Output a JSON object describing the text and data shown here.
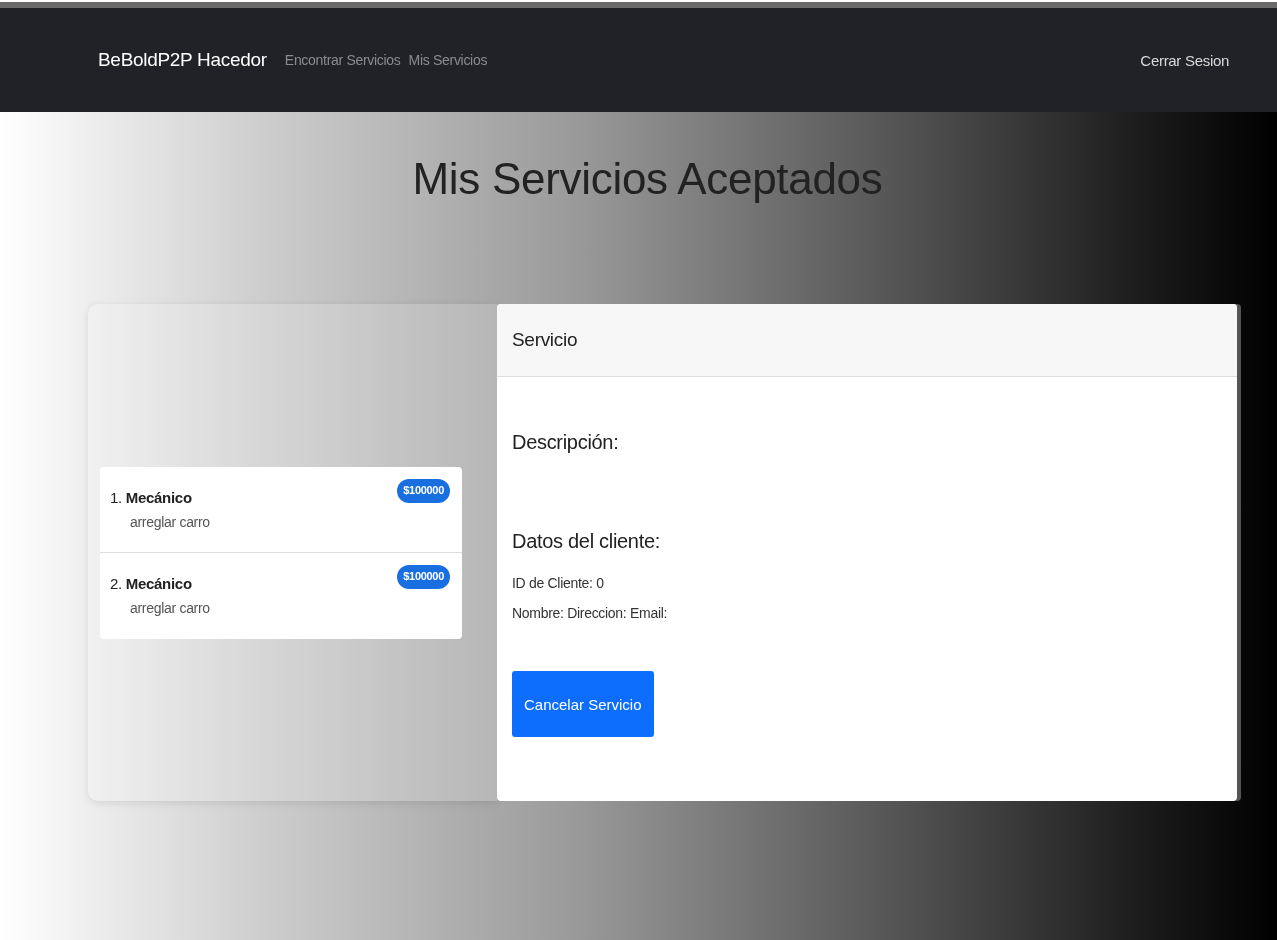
{
  "navbar": {
    "brand": "BeBoldP2P Hacedor",
    "links": [
      {
        "label": "Encontrar Servicios"
      },
      {
        "label": "Mis Servicios"
      }
    ],
    "logout": "Cerrar Sesion"
  },
  "page_title": "Mis Servicios Aceptados",
  "services": [
    {
      "number": "1.",
      "title": "Mecánico",
      "subtitle": "arreglar carro",
      "badge": "$100000"
    },
    {
      "number": "2.",
      "title": "Mecánico",
      "subtitle": "arreglar carro",
      "badge": "$100000"
    }
  ],
  "detail": {
    "header": "Servicio",
    "description_heading": "Descripción:",
    "client_heading": "Datos del cliente:",
    "client_lines": [
      "ID de Cliente: 0",
      "Nombre: Direccion: Email:"
    ],
    "button": "Cancelar Servicio"
  }
}
